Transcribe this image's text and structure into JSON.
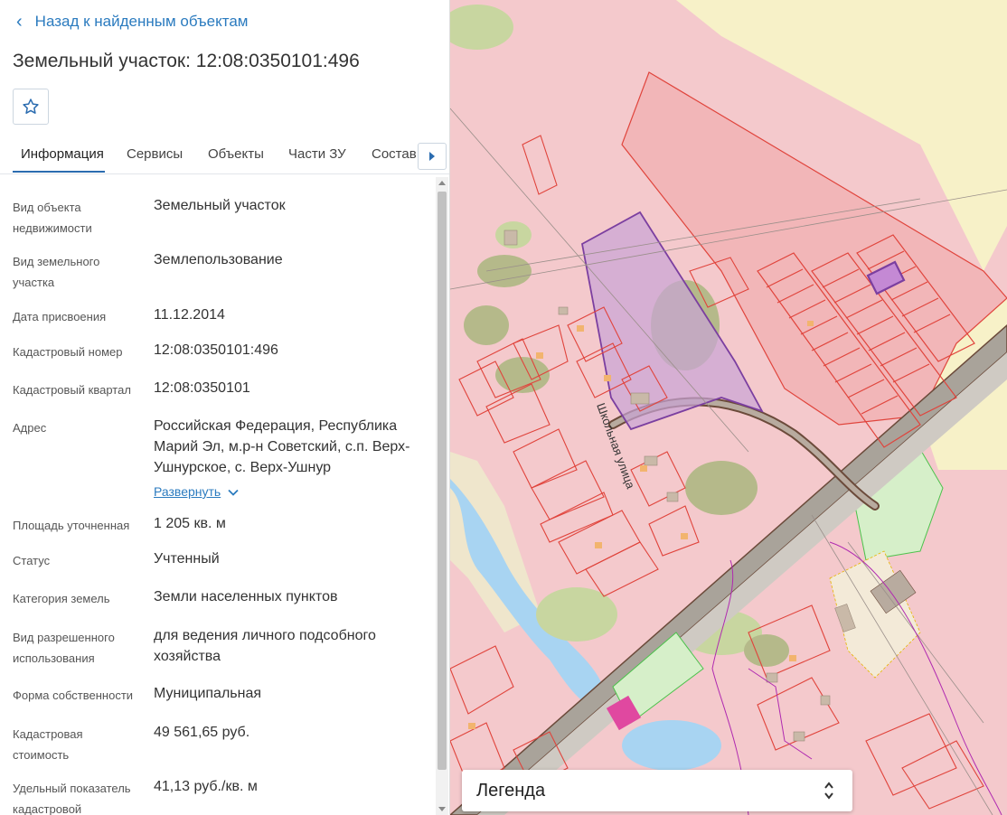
{
  "back_link": {
    "label": "Назад к найденным объектам"
  },
  "page_title": "Земельный участок: 12:08:0350101:496",
  "tabs": [
    {
      "label": "Информация",
      "active": true
    },
    {
      "label": "Сервисы"
    },
    {
      "label": "Объекты"
    },
    {
      "label": "Части ЗУ"
    },
    {
      "label": "Состав"
    }
  ],
  "info": {
    "object_type": {
      "label": "Вид объекта недвижимости",
      "value": "Земельный участок"
    },
    "land_type": {
      "label": "Вид земельного участка",
      "value": "Землепользование"
    },
    "assign_date": {
      "label": "Дата присвоения",
      "value": "11.12.2014"
    },
    "cadastral_number": {
      "label": "Кадастровый номер",
      "value": "12:08:0350101:496"
    },
    "cadastral_quarter": {
      "label": "Кадастровый квартал",
      "value": "12:08:0350101"
    },
    "address": {
      "label": "Адрес",
      "value": "Российская Федерация, Республика Марий Эл, м.р-н Советский, с.п. Верх-Ушнурское, с. Верх-Ушнур",
      "expand_label": "Развернуть"
    },
    "area": {
      "label": "Площадь уточненная",
      "value": "1 205 кв. м"
    },
    "status": {
      "label": "Статус",
      "value": "Учтенный"
    },
    "land_category": {
      "label": "Категория земель",
      "value": "Земли населенных пунктов"
    },
    "permitted_use": {
      "label": "Вид разрешенного использования",
      "value": "для ведения личного подсобного хозяйства"
    },
    "ownership": {
      "label": "Форма собственности",
      "value": "Муниципальная"
    },
    "cadastral_value": {
      "label": "Кадастровая стоимость",
      "value": "49 561,65 руб."
    },
    "specific_value": {
      "label": "Удельный показатель кадастровой",
      "value": "41,13 руб./кв. м"
    }
  },
  "map": {
    "street_label": "Школьная улица",
    "colors": {
      "residential": "#f4c9cc",
      "field": "#f7f1c8",
      "parcel_border": "#e0443c",
      "selected": "#7b3fa0",
      "road": "#a9a39a",
      "water": "#a8d4f2",
      "forest": "#b5b98a",
      "green_zone": "#d6efc9"
    }
  },
  "legend": {
    "label": "Легенда"
  }
}
